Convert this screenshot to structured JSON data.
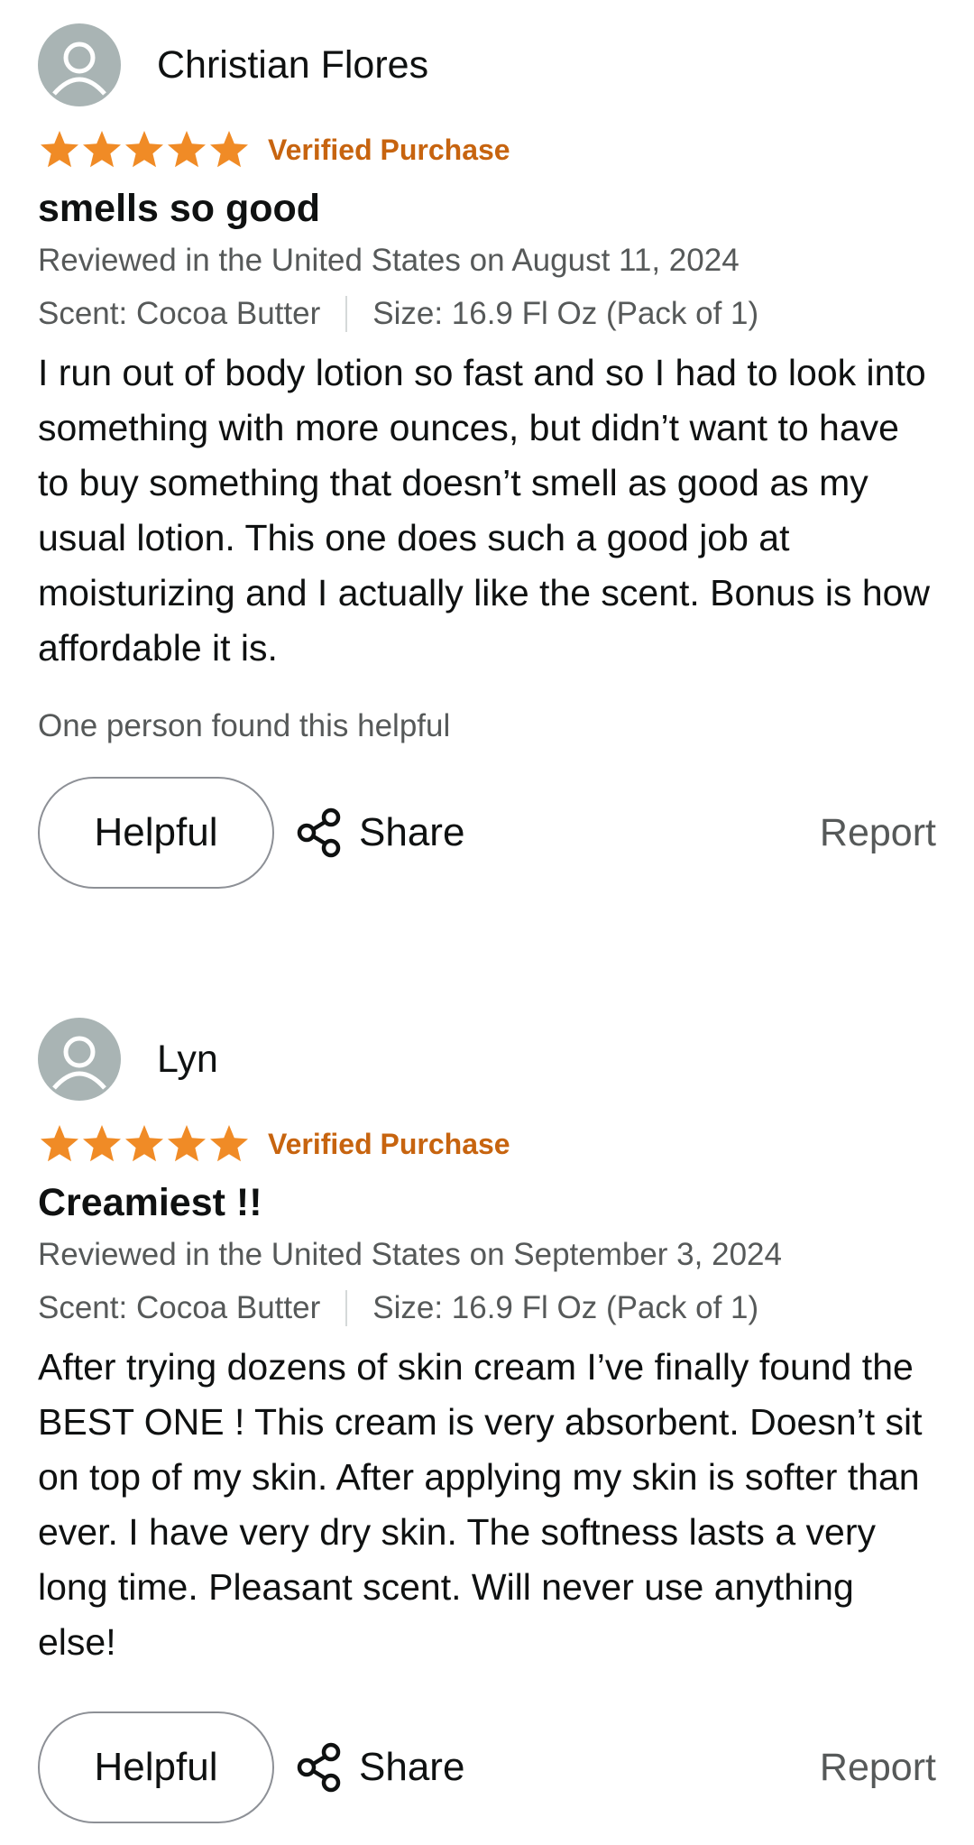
{
  "colors": {
    "star": "#f08b26",
    "verified": "#c7640f",
    "meta_text": "#565959",
    "avatar_bg": "#a9b4b4"
  },
  "reviews": [
    {
      "author": "Christian Flores",
      "rating": 5,
      "verified": "Verified Purchase",
      "title": "smells so good",
      "date_line": "Reviewed in the United States on August 11, 2024",
      "scent": "Scent: Cocoa Butter",
      "size": "Size: 16.9 Fl Oz (Pack of 1)",
      "body": "I run out of body lotion so fast and so I had to look into something with more ounces, but didn’t want to have to buy something that doesn’t smell as good as my usual lotion. This one does such a good job at moisturizing and I actually like the scent. Bonus is how affordable it is.",
      "helpful_count": "One person found this helpful",
      "helpful_label": "Helpful",
      "share_label": "Share",
      "report_label": "Report"
    },
    {
      "author": "Lyn",
      "rating": 5,
      "verified": "Verified Purchase",
      "title": "Creamiest !!",
      "date_line": "Reviewed in the United States on September 3, 2024",
      "scent": "Scent: Cocoa Butter",
      "size": "Size: 16.9 Fl Oz (Pack of 1)",
      "body": "After trying dozens of skin cream I’ve finally found the BEST ONE ! This cream is very absorbent. Doesn’t sit on top of my skin. After applying my skin is softer than ever. I have very dry skin. The softness lasts a very long time. Pleasant scent. Will never use anything else!",
      "helpful_label": "Helpful",
      "share_label": "Share",
      "report_label": "Report"
    }
  ]
}
